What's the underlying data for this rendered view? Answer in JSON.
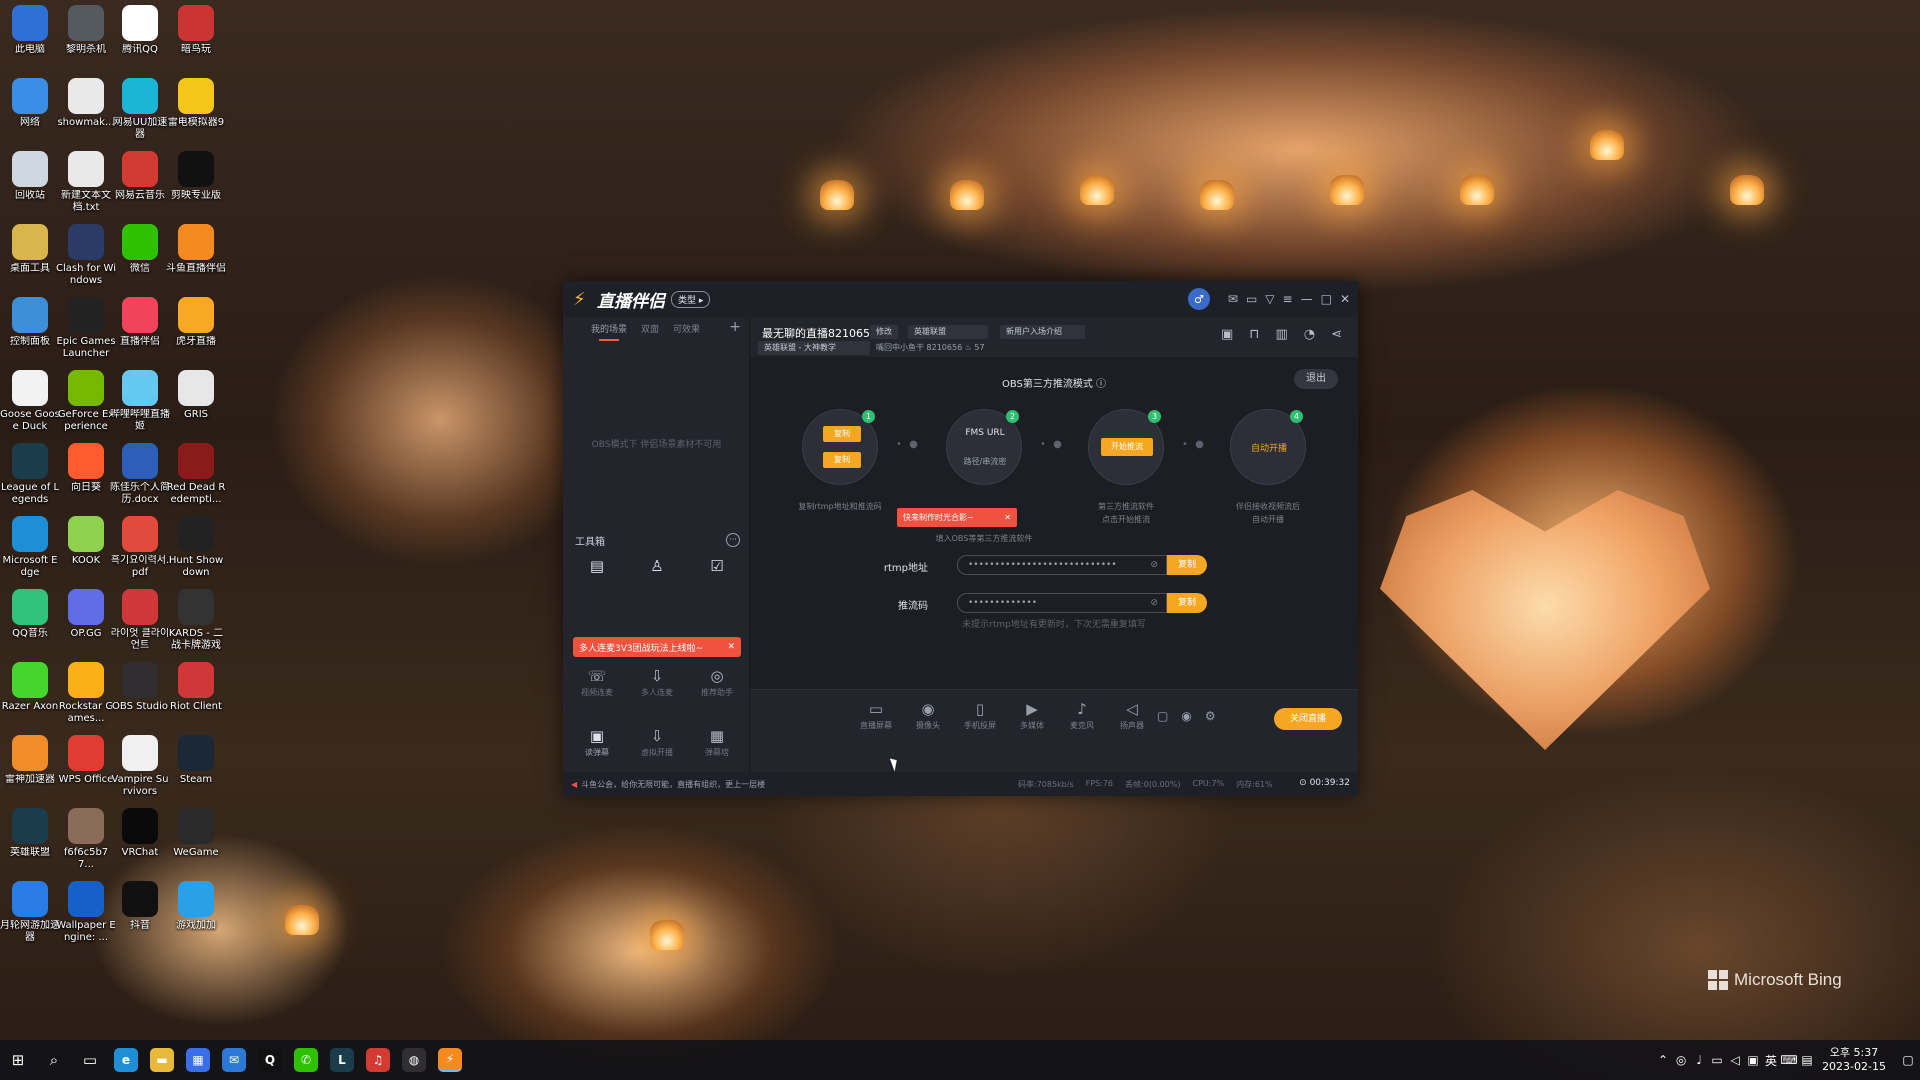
{
  "desktop": {
    "wallpaper_brand": "Microsoft Bing",
    "icons": [
      {
        "label": "此电脑",
        "color": "#2f6fd6",
        "icon": "computer-icon"
      },
      {
        "label": "黎明杀机",
        "color": "#555a60",
        "icon": "dbd-icon"
      },
      {
        "label": "腾讯QQ",
        "color": "#ffffff",
        "icon": "qq-icon"
      },
      {
        "label": "暗鸟玩",
        "color": "#c33",
        "icon": "game-icon"
      },
      {
        "label": "网络",
        "color": "#3a8ee6",
        "icon": "network-icon"
      },
      {
        "label": "showmak...",
        "color": "#e9e9e9",
        "icon": "file-icon"
      },
      {
        "label": "网易UU加速器",
        "color": "#1bb6d6",
        "icon": "uu-icon"
      },
      {
        "label": "雷电模拟器9",
        "color": "#f5c518",
        "icon": "ldplayer-icon"
      },
      {
        "label": "回收站",
        "color": "#cfd8e0",
        "icon": "recycle-bin-icon"
      },
      {
        "label": "新建文本文档.txt",
        "color": "#e9e9e9",
        "icon": "text-file-icon"
      },
      {
        "label": "网易云音乐",
        "color": "#d33a31",
        "icon": "netease-music-icon"
      },
      {
        "label": "剪映专业版",
        "color": "#111111",
        "icon": "capcut-icon"
      },
      {
        "label": "桌面工具",
        "color": "#d9b64c",
        "icon": "folder-icon"
      },
      {
        "label": "Clash for Windows",
        "color": "#2b3a67",
        "icon": "clash-icon"
      },
      {
        "label": "微信",
        "color": "#2dc100",
        "icon": "wechat-icon"
      },
      {
        "label": "斗鱼直播伴侣",
        "color": "#f58a1f",
        "icon": "douyu-icon"
      },
      {
        "label": "控制面板",
        "color": "#3d8fd8",
        "icon": "control-panel-icon"
      },
      {
        "label": "Epic Games Launcher",
        "color": "#222222",
        "icon": "epic-icon"
      },
      {
        "label": "直播伴侣",
        "color": "#f0445a",
        "icon": "live-companion-icon"
      },
      {
        "label": "虎牙直播",
        "color": "#f9a825",
        "icon": "huya-icon"
      },
      {
        "label": "Goose Goose Duck",
        "color": "#f2f2f2",
        "icon": "goose-icon"
      },
      {
        "label": "GeForce Experience",
        "color": "#76b900",
        "icon": "nvidia-icon"
      },
      {
        "label": "哔哩哔哩直播姬",
        "color": "#65c8f0",
        "icon": "bilibili-icon"
      },
      {
        "label": "GRIS",
        "color": "#e7e7e7",
        "icon": "gris-icon"
      },
      {
        "label": "League of Legends",
        "color": "#1b3c4a",
        "icon": "lol-icon"
      },
      {
        "label": "向日葵",
        "color": "#ff5b2e",
        "icon": "sunflower-icon"
      },
      {
        "label": "陈佳乐个人简历.docx",
        "color": "#2b5fb8",
        "icon": "word-doc-icon"
      },
      {
        "label": "Red Dead Redempti...",
        "color": "#8b1a1a",
        "icon": "rdr-icon"
      },
      {
        "label": "Microsoft Edge",
        "color": "#1e8fd6",
        "icon": "edge-icon"
      },
      {
        "label": "KOOK",
        "color": "#8fd14f",
        "icon": "kook-icon"
      },
      {
        "label": "흑기요이력서.pdf",
        "color": "#e24a3b",
        "icon": "pdf-icon"
      },
      {
        "label": "Hunt Showdown",
        "color": "#222222",
        "icon": "hunt-icon"
      },
      {
        "label": "QQ音乐",
        "color": "#31c27c",
        "icon": "qq-music-icon"
      },
      {
        "label": "OP.GG",
        "color": "#5f6ee8",
        "icon": "opgg-icon"
      },
      {
        "label": "라이엇 클라이언트",
        "color": "#d13639",
        "icon": "riot-icon"
      },
      {
        "label": "KARDS - 二战卡牌游戏",
        "color": "#333333",
        "icon": "kards-icon"
      },
      {
        "label": "Razer Axon",
        "color": "#44d62c",
        "icon": "razer-icon"
      },
      {
        "label": "Rockstar Games...",
        "color": "#fcaf17",
        "icon": "rockstar-icon"
      },
      {
        "label": "OBS Studio",
        "color": "#302e31",
        "icon": "obs-icon"
      },
      {
        "label": "Riot Client",
        "color": "#d13639",
        "icon": "riot-client-icon"
      },
      {
        "label": "雷神加速器",
        "color": "#f28c28",
        "icon": "leishen-icon"
      },
      {
        "label": "WPS Office",
        "color": "#e03c31",
        "icon": "wps-icon"
      },
      {
        "label": "Vampire Survivors",
        "color": "#f0f0f0",
        "icon": "vampire-icon"
      },
      {
        "label": "Steam",
        "color": "#1b2838",
        "icon": "steam-icon"
      },
      {
        "label": "英雄联盟",
        "color": "#1b3c4a",
        "icon": "lol-cn-icon"
      },
      {
        "label": "f6f6c5b77...",
        "color": "#8a6b5a",
        "icon": "image-file-icon"
      },
      {
        "label": "VRChat",
        "color": "#0a0a0a",
        "icon": "vrchat-icon"
      },
      {
        "label": "WeGame",
        "color": "#2a2a2a",
        "icon": "wegame-icon"
      },
      {
        "label": "月轮网游加速器",
        "color": "#2a7be4",
        "icon": "moon-accel-icon"
      },
      {
        "label": "Wallpaper Engine: ...",
        "color": "#1660c9",
        "icon": "wallpaper-engine-icon"
      },
      {
        "label": "抖音",
        "color": "#111111",
        "icon": "douyin-icon"
      },
      {
        "label": "游戏加加",
        "color": "#2aa0e8",
        "icon": "game-plus-icon"
      }
    ]
  },
  "app": {
    "brand": "直播伴侣",
    "type_pill": "类型 ▸",
    "scene_tabs": [
      "我的场景",
      "双面",
      "可效果"
    ],
    "scene_add": "+",
    "obs_note": "OBS模式下 伴侣场景素材不可用",
    "toolbox_title": "工具箱",
    "promo_toast": "多人连麦3V3团战玩法上线啦~",
    "tools": [
      {
        "label": "",
        "icon": "screen-tool-icon"
      },
      {
        "label": "",
        "icon": "user-tool-icon"
      },
      {
        "label": "",
        "icon": "task-tool-icon"
      },
      {
        "label": "视频连麦",
        "icon": "video-link-icon"
      },
      {
        "label": "多人连麦",
        "icon": "multi-link-icon"
      },
      {
        "label": "推荐助手",
        "icon": "recommend-icon"
      },
      {
        "label": "读弹幕",
        "icon": "read-danmaku-icon"
      },
      {
        "label": "虚拟开播",
        "icon": "virtual-live-icon"
      },
      {
        "label": "弹幕塔",
        "icon": "danmaku-tower-icon"
      }
    ],
    "room_title": "最无聊的直播8210656",
    "edit_btn": "修改",
    "category_chip": "英雄联盟",
    "intro_chip": "新用户入场介绍",
    "tag_chip": "英雄联盟 - 大神教学",
    "room_meta": "嘴回中小鱼干  8210656  ♨ 57",
    "obs_mode_title": "OBS第三方推流模式",
    "exit_label": "退出",
    "steps": [
      {
        "badge": "1",
        "desc": "复制rtmp地址和推流码",
        "btn1": "复制",
        "btn2": "复制"
      },
      {
        "badge": "2",
        "desc": "填入OBS等第三方推流软件",
        "inner_top": "FMS URL",
        "inner_bottom": "路径/串流密"
      },
      {
        "badge": "3",
        "desc_line1": "第三方推流软件",
        "desc_line2": "点击开始推流",
        "btn": "开始推流"
      },
      {
        "badge": "4",
        "desc_line1": "伴侣接收视频流后",
        "desc_line2": "自动开播",
        "inner": "自动开播"
      }
    ],
    "tip_red": "快来制作时光合影~",
    "rtmp_label": "rtmp地址",
    "rtmp_value": "••••••••••••••••••••••••••••",
    "push_label": "推流码",
    "push_value": "•••••••••••••",
    "copy_label": "复制",
    "field_hint": "未提示rtmp地址有更新时，下次无需重复填写",
    "controls": [
      {
        "label": "直播屏幕",
        "icon": "screen-capture-icon"
      },
      {
        "label": "摄像头",
        "icon": "camera-icon"
      },
      {
        "label": "手机投屏",
        "icon": "phone-cast-icon"
      },
      {
        "label": "多媒体",
        "icon": "media-icon"
      },
      {
        "label": "麦克风",
        "icon": "microphone-icon"
      },
      {
        "label": "扬声器",
        "icon": "speaker-icon"
      }
    ],
    "close_live": "关闭直播",
    "notice": "斗鱼公会，给你无限可能，直播有组织，更上一层楼",
    "stats": [
      "码率:7085kb/s",
      "FPS:76",
      "丢帧:0(0.00%)",
      "CPU:7%",
      "内存:61%"
    ],
    "timer": "⊙ 00:39:32"
  },
  "taskbar": {
    "time": "오후 5:37",
    "date": "2023-02-15",
    "lang": "英"
  }
}
